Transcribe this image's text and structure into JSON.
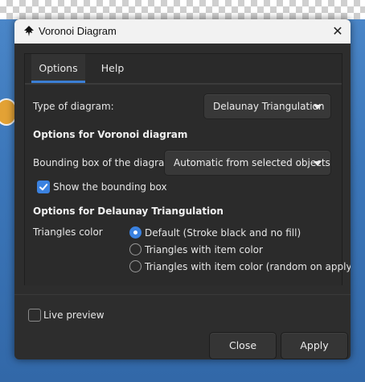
{
  "window": {
    "title": "Voronoi Diagram",
    "icon": "inkscape-icon",
    "close_glyph": "✕"
  },
  "tabs": [
    {
      "label": "Options",
      "active": true
    },
    {
      "label": "Help",
      "active": false
    }
  ],
  "options": {
    "type_label": "Type of diagram:",
    "type_value": "Delaunay Triangulation",
    "voronoi_heading": "Options for Voronoi diagram",
    "bbox_label": "Bounding box of the diagram:",
    "bbox_value": "Automatic from selected objects",
    "show_bbox_label": "Show the bounding box",
    "show_bbox_checked": true,
    "delaunay_heading": "Options for Delaunay Triangulation",
    "triangles_color_label": "Triangles color",
    "triangle_options": [
      {
        "label": "Default (Stroke black and no fill)",
        "selected": true
      },
      {
        "label": "Triangles with item color",
        "selected": false
      },
      {
        "label": "Triangles with item color (random on apply)",
        "selected": false
      }
    ]
  },
  "live_preview": {
    "label": "Live preview",
    "checked": false
  },
  "buttons": {
    "close": "Close",
    "apply": "Apply"
  },
  "colors": {
    "accent": "#3b82e0",
    "dialog_bg": "#2d2d2d",
    "titlebar_bg": "#f2f2f2"
  }
}
